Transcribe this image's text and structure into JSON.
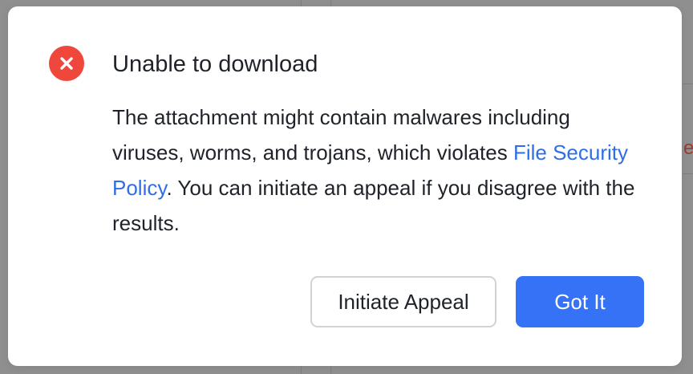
{
  "dialog": {
    "title": "Unable to download",
    "status_icon": "close-circle-icon",
    "body_before_link": "The attachment might contain malwares including viruses, worms, and trojans, which violates ",
    "link_text": "File Security Policy",
    "body_after_link": ". You can initiate an appeal if you disagree with the results.",
    "secondary_button": "Initiate Appeal",
    "primary_button": "Got It"
  },
  "background": {
    "partial_glyph": "e"
  },
  "colors": {
    "error": "#f0473d",
    "link": "#2f6ee6",
    "primary": "#3572f6",
    "text": "#1f2329"
  }
}
